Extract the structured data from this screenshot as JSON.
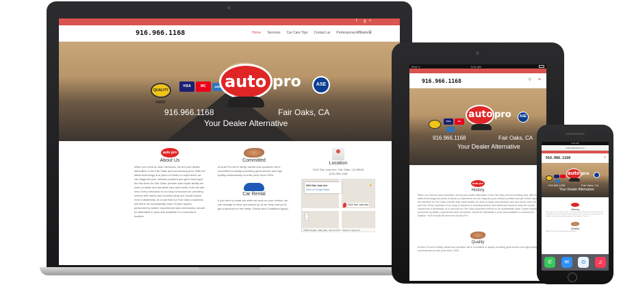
{
  "site": {
    "phone_logo": "916.966.1168",
    "social_icons": "f g+",
    "nav": [
      "Home",
      "Services",
      "Car Care Tips",
      "Contact us",
      "Professional Affiliations"
    ],
    "search_glyph": "⚲"
  },
  "hero": {
    "badge_quality": "QUALITY FIRST",
    "card_visa": "VISA",
    "card_mc": "MC",
    "card_amex": "AMEX",
    "brand_auto": "auto",
    "brand_pro": "pro",
    "ase": "ASE",
    "phone": "916.966.1168",
    "city": "Fair Oaks, CA",
    "tagline": "Your Dealer Alternative"
  },
  "about": {
    "logo": "auto pro",
    "title": "About Us",
    "body": "When you need an auto mechanic, we are your dealer alternative in the Fair Oaks and surrounding area. With the latest technology and years of hands on experience we can diagnose your vehicles problem and get it fixed right the first time! As Fair Oaks' premier auto repair facility we work on Asian and domestic cars and trucks, both old and new. Every mechanic in our shop is focused on providing service that meets and exceeds what one would expect from a dealership, at a cost that our Fair Oaks customers will find to be substantially lower. Expert repairs, performed by skilled, experienced auto mechanics, should be affordable in price and available in a convenient location."
  },
  "committed": {
    "title": "Committed",
    "body": "At Auto Pro we're family owned and operated; we're committed to always providing great service and high quality workmanship at a fair price since 1994."
  },
  "car_rental": {
    "title": "Car Rental",
    "body": "If you need a rental car while we work on your vehicle, we can arrange to have you picked up at our shop and you'll get a discount on the rental. (Terms and Conditions Apply)"
  },
  "location": {
    "title": "Location",
    "address": "5344 San Juan Ave, Fair Oaks, CA 95628",
    "phone": "(916) 966-1168",
    "map_card_title": "5344 San Juan Ave",
    "map_card_link": "View on Google Maps",
    "marker_label": "5344 San Juan Ave",
    "map_footer": "©2016 Google · Map data · Terms of Use · Report a map error",
    "zoom": "+ −"
  },
  "tablet": {
    "status_left": "iPad ᯤ",
    "status_time": "9:41 AM",
    "history_logo": "auto pro",
    "history_title": "History",
    "history_body": "When you need an auto mechanic, we are your dealer alternative in the Fair Oaks and surrounding area. With the latest technology and years of hands on experience we can diagnose your vehicles problem and get it fixed right the first time! As Fair Oaks' premier auto repair facility, we work on Asian and domestic cars and trucks, both old and new. Every mechanic in our shop is focused on providing service that meets and exceeds what one would expect from a dealership, at a cost that our Fair Oaks customers will find to be substantially lower. Expert repairs, performed by skilled, experienced auto mechanics, should be affordable in price and available in a convenient location. You'll find all this and more at Auto Pro.",
    "quality_title": "Quality",
    "quality_body": "At Auto Pro we're family owned and operated, we're committed to always providing great service and high quality workmanship at a fair price since 1994.",
    "burger": "≡"
  },
  "phone_device": {
    "status_time": "9:41 AM",
    "url": "autoprofairoaks.com",
    "history_title": "History",
    "quality_title": "Quality",
    "history_body": "When you need an auto mechanic, we are your dealer alternative in the Fair Oaks and surrounding area. With the latest technology and years of hands on experience we can diagnose your vehicles problem and get it fixed right the first time!",
    "quality_body": "At Auto Pro we're family owned and operated.",
    "dock": [
      "✆",
      "✉",
      "⊙",
      "♫"
    ]
  }
}
